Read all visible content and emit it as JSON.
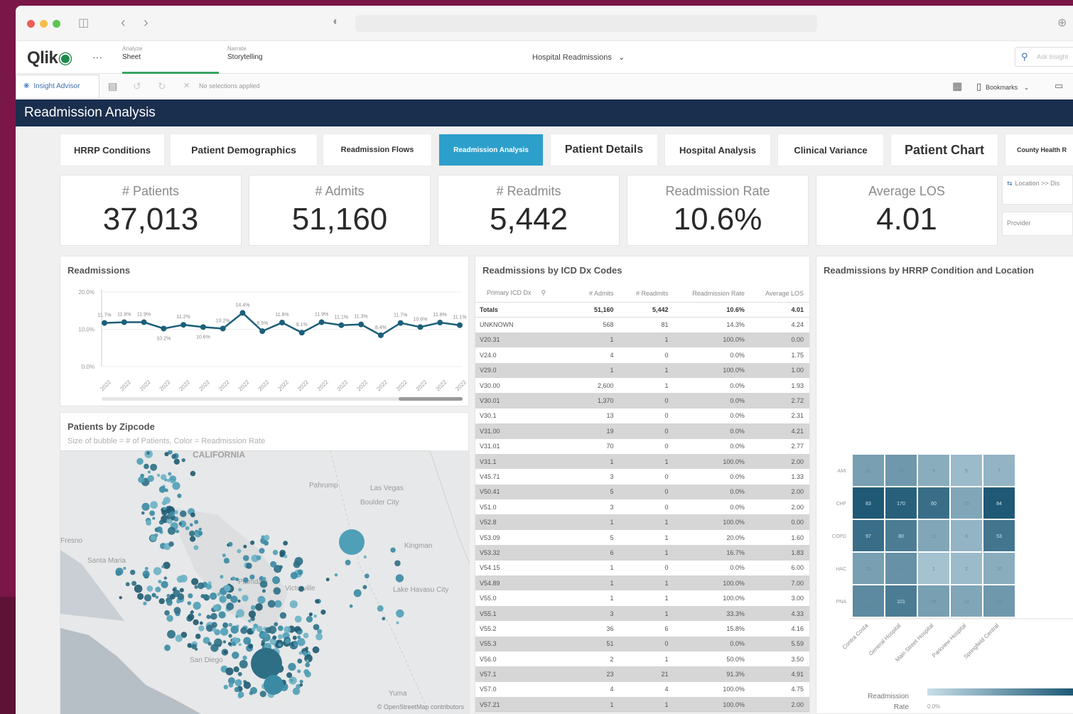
{
  "browser": {
    "traffic_lights": [
      "#ec5f57",
      "#f4be4e",
      "#5fc454"
    ]
  },
  "app": {
    "logo_text": "Qlik",
    "more": "···",
    "nav": [
      {
        "small": "Analyze",
        "big": "Sheet"
      },
      {
        "small": "Narrate",
        "big": "Storytelling"
      }
    ],
    "app_title": "Hospital Readmissions",
    "search_placeholder": "Ask Insight"
  },
  "toolbar": {
    "insight_advisor": "Insight Advisor",
    "selections": "No selections applied",
    "bookmarks": "Bookmarks"
  },
  "sheet_title": "Readmission Analysis",
  "tabs": [
    {
      "label": "HRRP Conditions"
    },
    {
      "label": "Patient Demographics"
    },
    {
      "label": "Readmission Flows"
    },
    {
      "label": "Readmission Analysis"
    },
    {
      "label": "Patient Details"
    },
    {
      "label": "Hospital Analysis"
    },
    {
      "label": "Clinical Variance"
    },
    {
      "label": "Patient Chart"
    },
    {
      "label": "County Health R"
    }
  ],
  "kpis": [
    {
      "title": "# Patients",
      "value": "37,013"
    },
    {
      "title": "# Admits",
      "value": "51,160"
    },
    {
      "title": "# Readmits",
      "value": "5,442"
    },
    {
      "title": "Readmission Rate",
      "value": "10.6%"
    },
    {
      "title": "Average LOS",
      "value": "4.01"
    }
  ],
  "filters": {
    "location": "Location >> Dis",
    "provider": "Provider"
  },
  "readmissions_panel": {
    "title": "Readmissions"
  },
  "chart_data": {
    "type": "line",
    "title": "Readmissions",
    "y_ticks": [
      "20.0%",
      "10.0%",
      "0.0%"
    ],
    "ylim": [
      0,
      20
    ],
    "grid": true,
    "values": [
      11.7,
      11.9,
      11.9,
      10.2,
      11.2,
      10.6,
      10.2,
      14.4,
      9.5,
      11.8,
      9.1,
      11.9,
      11.1,
      11.3,
      8.4,
      11.7,
      10.6,
      11.8,
      11.1
    ],
    "labels": [
      "11.7%",
      "11.9%",
      "11.9%",
      "10.2%",
      "11.2%",
      "10.6%",
      "10.2%",
      "14.4%",
      "9.5%",
      "11.8%",
      "9.1%",
      "11.9%",
      "11.1%",
      "11.3%",
      "8.4%",
      "11.7%",
      "10.6%",
      "11.8%",
      "11.1%"
    ],
    "x_tick_label": "2022",
    "color": "#1b5f7a"
  },
  "map_panel": {
    "title": "Patients by Zipcode",
    "subtitle": "Size of bubble = # of Patients, Color = Readmission Rate",
    "attribution": "© OpenStreetMap contributors",
    "places": [
      {
        "name": "CALIFORNIA"
      },
      {
        "name": "Pahrump"
      },
      {
        "name": "Las Vegas"
      },
      {
        "name": "Boulder City"
      },
      {
        "name": "Kingman"
      },
      {
        "name": "Lake Havasu City"
      },
      {
        "name": "Santa Maria"
      },
      {
        "name": "Fresno"
      },
      {
        "name": "Palmdale"
      },
      {
        "name": "Victorville"
      },
      {
        "name": "San Diego"
      },
      {
        "name": "Yuma"
      }
    ]
  },
  "icd_panel": {
    "title": "Readmissions by ICD Dx Codes",
    "columns": [
      "Primary ICD Dx",
      "# Admits",
      "# Readmits",
      "Readmission Rate",
      "Average LOS"
    ],
    "totals": [
      "Totals",
      "51,160",
      "5,442",
      "10.6%",
      "4.01"
    ],
    "rows": [
      [
        "UNKNOWN",
        "568",
        "81",
        "14.3%",
        "4.24"
      ],
      [
        "V20.31",
        "1",
        "1",
        "100.0%",
        "0.00"
      ],
      [
        "V24.0",
        "4",
        "0",
        "0.0%",
        "1.75"
      ],
      [
        "V29.0",
        "1",
        "1",
        "100.0%",
        "1.00"
      ],
      [
        "V30.00",
        "2,600",
        "1",
        "0.0%",
        "1.93"
      ],
      [
        "V30.01",
        "1,370",
        "0",
        "0.0%",
        "2.72"
      ],
      [
        "V30.1",
        "13",
        "0",
        "0.0%",
        "2.31"
      ],
      [
        "V31.00",
        "19",
        "0",
        "0.0%",
        "4.21"
      ],
      [
        "V31.01",
        "70",
        "0",
        "0.0%",
        "2.77"
      ],
      [
        "V31.1",
        "1",
        "1",
        "100.0%",
        "2.00"
      ],
      [
        "V45.71",
        "3",
        "0",
        "0.0%",
        "1.33"
      ],
      [
        "V50.41",
        "5",
        "0",
        "0.0%",
        "2.00"
      ],
      [
        "V51.0",
        "3",
        "0",
        "0.0%",
        "2.00"
      ],
      [
        "V52.8",
        "1",
        "1",
        "100.0%",
        "0.00"
      ],
      [
        "V53.09",
        "5",
        "1",
        "20.0%",
        "1.60"
      ],
      [
        "V53.32",
        "6",
        "1",
        "16.7%",
        "1.83"
      ],
      [
        "V54.15",
        "1",
        "0",
        "0.0%",
        "6.00"
      ],
      [
        "V54.89",
        "1",
        "1",
        "100.0%",
        "7.00"
      ],
      [
        "V55.0",
        "1",
        "1",
        "100.0%",
        "3.00"
      ],
      [
        "V55.1",
        "3",
        "1",
        "33.3%",
        "4.33"
      ],
      [
        "V55.2",
        "36",
        "6",
        "15.8%",
        "4.16"
      ],
      [
        "V55.3",
        "51",
        "0",
        "0.0%",
        "5.59"
      ],
      [
        "V56.0",
        "2",
        "1",
        "50.0%",
        "3.50"
      ],
      [
        "V57.1",
        "23",
        "21",
        "91.3%",
        "4.91"
      ],
      [
        "V57.0",
        "4",
        "4",
        "100.0%",
        "4.75"
      ],
      [
        "V57.21",
        "1",
        "1",
        "100.0%",
        "2.00"
      ]
    ]
  },
  "heatmap_panel": {
    "title": "Readmissions by HRRP Condition and Location",
    "rows": [
      "AMI",
      "CHF",
      "COPD",
      "HAC",
      "PNA"
    ],
    "cols": [
      "Contra Costa",
      "General Hospital",
      "Main Street Hospital",
      "Parkview Hospital",
      "Springfield Central"
    ],
    "cells": [
      [
        "31",
        "38",
        "9",
        "5",
        "7"
      ],
      [
        "83",
        "170",
        "60",
        "15",
        "84"
      ],
      [
        "97",
        "80",
        "11",
        "8",
        "53"
      ],
      [
        "20",
        "48",
        "1",
        "2",
        "10"
      ],
      [
        "50",
        "101",
        "26",
        "18",
        "26"
      ]
    ],
    "levels": [
      [
        0.45,
        0.5,
        0.35,
        0.25,
        0.3
      ],
      [
        0.95,
        0.9,
        0.8,
        0.4,
        0.95
      ],
      [
        0.8,
        0.7,
        0.4,
        0.3,
        0.75
      ],
      [
        0.45,
        0.55,
        0.2,
        0.25,
        0.35
      ],
      [
        0.6,
        0.7,
        0.45,
        0.4,
        0.5
      ]
    ],
    "legend_title": "Readmission Rate",
    "legend_min": "0.0%"
  }
}
